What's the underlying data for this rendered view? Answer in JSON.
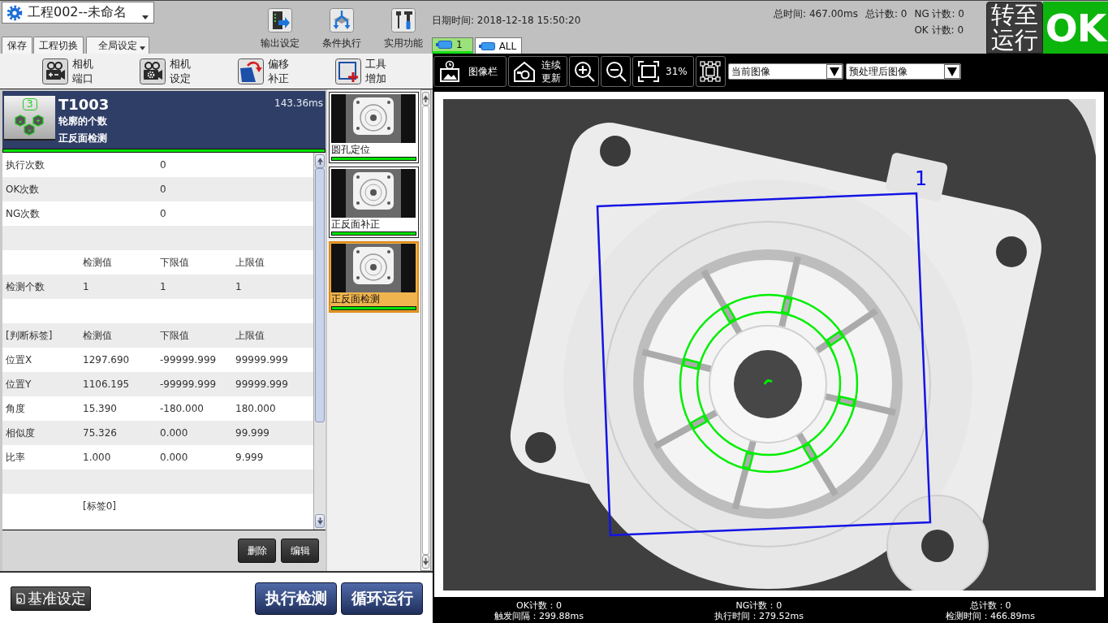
{
  "project": {
    "name": "工程002--未命名"
  },
  "menu_buttons": [
    {
      "label": "保存",
      "kind": "button"
    },
    {
      "label": "工程切换",
      "kind": "button"
    },
    {
      "label": "全局设定",
      "kind": "dropdown"
    }
  ],
  "toolbar": [
    {
      "label": "输出设定"
    },
    {
      "label": "条件执行"
    },
    {
      "label": "实用功能"
    }
  ],
  "datetime": "日期时间: 2018-12-18 15:50:20",
  "camera_tabs": [
    {
      "label": "1",
      "selected": true
    },
    {
      "label": "ALL",
      "selected": false
    }
  ],
  "summary": {
    "total_time": "总时间: 467.00ms",
    "total_count": "总计数: 0",
    "ng_count": "NG 计数: 0",
    "ok_count": "OK 计数: 0"
  },
  "run_button": {
    "label": "转至运行"
  },
  "result": {
    "label": "OK",
    "ok": true
  },
  "tool_buttons": [
    {
      "label": "相机端口"
    },
    {
      "label": "相机设定"
    },
    {
      "label": "偏移补正"
    },
    {
      "label": "工具增加"
    }
  ],
  "tool_header": {
    "badge": "3",
    "code": "T1003",
    "type": "轮廓的个数",
    "name": "正反面检测",
    "time": "143.36ms",
    "ok": true
  },
  "result_table": {
    "rows": [
      {
        "kind": "stat",
        "label": "执行次数",
        "value": "0"
      },
      {
        "kind": "stat",
        "label": "OK次数",
        "value": "0"
      },
      {
        "kind": "stat",
        "label": "NG次数",
        "value": "0"
      },
      {
        "kind": "blank"
      },
      {
        "kind": "values",
        "cells": [
          "检测值",
          "下限值",
          "上限值"
        ]
      },
      {
        "kind": "values",
        "label": "检测个数",
        "cells": [
          "1",
          "1",
          "1"
        ]
      },
      {
        "kind": "blank"
      },
      {
        "kind": "values",
        "label": "[判断标签]",
        "cells": [
          "检测值",
          "下限值",
          "上限值"
        ]
      },
      {
        "kind": "values",
        "label": "位置X",
        "cells": [
          "1297.690",
          "-99999.999",
          "99999.999"
        ]
      },
      {
        "kind": "values",
        "label": "位置Y",
        "cells": [
          "1106.195",
          "-99999.999",
          "99999.999"
        ]
      },
      {
        "kind": "values",
        "label": "角度",
        "cells": [
          "15.390",
          "-180.000",
          "180.000"
        ]
      },
      {
        "kind": "values",
        "label": "相似度",
        "cells": [
          "75.326",
          "0.000",
          "99.999"
        ]
      },
      {
        "kind": "values",
        "label": "比率",
        "cells": [
          "1.000",
          "0.000",
          "9.999"
        ]
      },
      {
        "kind": "blank"
      },
      {
        "kind": "values",
        "cells": [
          "[标签0]"
        ]
      }
    ]
  },
  "table_buttons": [
    {
      "label": "删除"
    },
    {
      "label": "编辑"
    }
  ],
  "tool_list": [
    {
      "label": "圆孔定位",
      "selected": false,
      "ok": true
    },
    {
      "label": "正反面补正",
      "selected": false,
      "ok": true
    },
    {
      "label": "正反面检测",
      "selected": true,
      "ok": true
    }
  ],
  "footer_buttons": [
    {
      "label": "基准设定",
      "kind": "secondary"
    },
    {
      "label": "执行检测",
      "kind": "primary"
    },
    {
      "label": "循环运行",
      "kind": "primary"
    }
  ],
  "image_toolbar": {
    "buttons": [
      {
        "kind": "image_bar",
        "label": "图像栏"
      },
      {
        "kind": "continuous",
        "label": "连续更新"
      },
      {
        "kind": "zoom_in"
      },
      {
        "kind": "zoom_out"
      },
      {
        "kind": "fit",
        "label": "31%"
      },
      {
        "kind": "select"
      }
    ],
    "dropdowns": [
      {
        "value": "当前图像"
      },
      {
        "value": "预处理后图像"
      }
    ]
  },
  "image": {
    "region_label": "1"
  },
  "status_bar": [
    {
      "count": "OK计数：0",
      "time": "触发间隔：299.88ms"
    },
    {
      "count": "NG计数：0",
      "time": "执行时间：279.52ms"
    },
    {
      "count": "总计数：0",
      "time": "检测时间：466.89ms"
    }
  ]
}
